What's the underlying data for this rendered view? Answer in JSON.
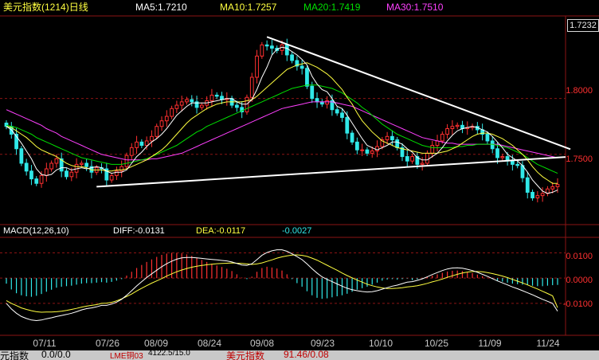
{
  "header": {
    "title": "美元指数(1214)日线",
    "ma5": "MA5:1.7210",
    "ma10": "MA10:1.7257",
    "ma20": "MA20:1.7419",
    "ma30": "MA30:1.7510"
  },
  "macd_header": {
    "label": "MACD(12,26,10)",
    "diff": "DIFF:-0.0131",
    "dea": "DEA:-0.0117",
    "macd": "-0.0027"
  },
  "price_axis": {
    "current": "1.7232",
    "ticks": [
      "1.8000",
      "1.7500"
    ]
  },
  "macd_axis": {
    "ticks": [
      "0.0100",
      "0.0000",
      "-0.0100"
    ]
  },
  "x_axis": {
    "ticks": [
      "07/11",
      "07/26",
      "08/09",
      "08/24",
      "09/08",
      "09/23",
      "10/10",
      "10/25",
      "11/09",
      "11/24"
    ]
  },
  "status_bar": {
    "left": "元指数",
    "left_value": "0.0/0.0",
    "mid": "LME铜03",
    "mid_value": "4122.5/15.0",
    "right": "美元指数",
    "right_value": "91.46/0.08"
  },
  "colors": {
    "up": "#ff3030",
    "down": "#30e8e8",
    "ma5": "#ffffff",
    "ma10": "#ffff40",
    "ma20": "#00e000",
    "ma30": "#ff40ff",
    "grid": "#8c1414",
    "trendline": "#ffffff"
  },
  "chart_data": [
    {
      "type": "candlestick",
      "title": "美元指数(1214)日线",
      "ylim": [
        1.6885,
        1.8725
      ],
      "x": [
        "07/11",
        "07/26",
        "08/09",
        "08/24",
        "09/08",
        "09/23",
        "10/10",
        "10/25",
        "11/09",
        "11/24"
      ],
      "close": [
        1.775,
        1.768,
        1.755,
        1.742,
        1.735,
        1.728,
        1.724,
        1.731,
        1.737,
        1.742,
        1.746,
        1.735,
        1.73,
        1.734,
        1.741,
        1.742,
        1.739,
        1.734,
        1.738,
        1.737,
        1.727,
        1.731,
        1.735,
        1.739,
        1.749,
        1.756,
        1.761,
        1.758,
        1.762,
        1.766,
        1.775,
        1.78,
        1.784,
        1.791,
        1.794,
        1.797,
        1.799,
        1.797,
        1.792,
        1.794,
        1.798,
        1.803,
        1.802,
        1.799,
        1.8,
        1.794,
        1.792,
        1.788,
        1.801,
        1.819,
        1.838,
        1.848,
        1.847,
        1.845,
        1.843,
        1.848,
        1.839,
        1.834,
        1.829,
        1.827,
        1.811,
        1.8,
        1.797,
        1.795,
        1.798,
        1.79,
        1.787,
        1.783,
        1.769,
        1.761,
        1.754,
        1.754,
        1.751,
        1.753,
        1.757,
        1.763,
        1.766,
        1.763,
        1.756,
        1.748,
        1.744,
        1.748,
        1.741,
        1.742,
        1.751,
        1.758,
        1.762,
        1.768,
        1.773,
        1.775,
        1.776,
        1.773,
        1.774,
        1.775,
        1.772,
        1.768,
        1.762,
        1.755,
        1.747,
        1.748,
        1.744,
        1.741,
        1.74,
        1.729,
        1.716,
        1.711,
        1.713,
        1.715,
        1.719,
        1.721,
        1.723
      ],
      "ma5": [
        1.775,
        1.772,
        1.766,
        1.76,
        1.753,
        1.746,
        1.737,
        1.732,
        1.731,
        1.732,
        1.736,
        1.738,
        1.738,
        1.736,
        1.737,
        1.738,
        1.737,
        1.738,
        1.739,
        1.738,
        1.735,
        1.733,
        1.734,
        1.734,
        1.736,
        1.742,
        1.748,
        1.752,
        1.757,
        1.761,
        1.764,
        1.768,
        1.773,
        1.779,
        1.785,
        1.789,
        1.793,
        1.796,
        1.796,
        1.796,
        1.796,
        1.797,
        1.798,
        1.799,
        1.8,
        1.8,
        1.797,
        1.795,
        1.795,
        1.799,
        1.808,
        1.819,
        1.828,
        1.839,
        1.844,
        1.846,
        1.845,
        1.842,
        1.839,
        1.835,
        1.83,
        1.82,
        1.813,
        1.808,
        1.806,
        1.8,
        1.793,
        1.791,
        1.785,
        1.778,
        1.771,
        1.764,
        1.758,
        1.756,
        1.754,
        1.756,
        1.758,
        1.761,
        1.761,
        1.759,
        1.755,
        1.752,
        1.747,
        1.745,
        1.745,
        1.748,
        1.751,
        1.756,
        1.762,
        1.767,
        1.771,
        1.773,
        1.774,
        1.775,
        1.774,
        1.772,
        1.77,
        1.766,
        1.761,
        1.756,
        1.75,
        1.747,
        1.744,
        1.74,
        1.734,
        1.727,
        1.722,
        1.717,
        1.715,
        1.716,
        1.718
      ],
      "ma10": [
        1.775,
        1.774,
        1.771,
        1.768,
        1.765,
        1.761,
        1.757,
        1.754,
        1.752,
        1.75,
        1.748,
        1.745,
        1.742,
        1.74,
        1.739,
        1.739,
        1.738,
        1.736,
        1.736,
        1.736,
        1.735,
        1.735,
        1.736,
        1.736,
        1.737,
        1.739,
        1.741,
        1.743,
        1.745,
        1.748,
        1.751,
        1.754,
        1.758,
        1.763,
        1.768,
        1.773,
        1.778,
        1.782,
        1.785,
        1.788,
        1.791,
        1.793,
        1.795,
        1.796,
        1.797,
        1.797,
        1.797,
        1.797,
        1.798,
        1.799,
        1.802,
        1.806,
        1.81,
        1.814,
        1.818,
        1.822,
        1.826,
        1.828,
        1.83,
        1.831,
        1.832,
        1.83,
        1.828,
        1.825,
        1.822,
        1.818,
        1.813,
        1.808,
        1.801,
        1.795,
        1.787,
        1.78,
        1.775,
        1.77,
        1.766,
        1.762,
        1.76,
        1.758,
        1.756,
        1.755,
        1.754,
        1.753,
        1.752,
        1.751,
        1.751,
        1.751,
        1.751,
        1.752,
        1.753,
        1.755,
        1.757,
        1.76,
        1.763,
        1.766,
        1.768,
        1.769,
        1.769,
        1.768,
        1.766,
        1.764,
        1.761,
        1.758,
        1.754,
        1.75,
        1.745,
        1.739,
        1.734,
        1.73,
        1.727,
        1.724,
        1.724
      ],
      "ma20": [
        1.776,
        1.775,
        1.774,
        1.772,
        1.77,
        1.768,
        1.765,
        1.763,
        1.761,
        1.759,
        1.757,
        1.755,
        1.753,
        1.751,
        1.749,
        1.747,
        1.746,
        1.745,
        1.744,
        1.743,
        1.742,
        1.741,
        1.741,
        1.741,
        1.742,
        1.743,
        1.744,
        1.745,
        1.746,
        1.748,
        1.75,
        1.752,
        1.754,
        1.756,
        1.758,
        1.761,
        1.764,
        1.767,
        1.77,
        1.772,
        1.775,
        1.777,
        1.779,
        1.781,
        1.783,
        1.785,
        1.787,
        1.789,
        1.791,
        1.793,
        1.795,
        1.797,
        1.799,
        1.801,
        1.803,
        1.805,
        1.807,
        1.809,
        1.81,
        1.811,
        1.812,
        1.812,
        1.812,
        1.811,
        1.81,
        1.809,
        1.807,
        1.805,
        1.802,
        1.799,
        1.796,
        1.792,
        1.789,
        1.785,
        1.781,
        1.777,
        1.774,
        1.771,
        1.768,
        1.766,
        1.764,
        1.762,
        1.76,
        1.758,
        1.757,
        1.756,
        1.756,
        1.756,
        1.756,
        1.756,
        1.757,
        1.757,
        1.758,
        1.758,
        1.759,
        1.759,
        1.759,
        1.759,
        1.758,
        1.757,
        1.756,
        1.754,
        1.752,
        1.75,
        1.747,
        1.744,
        1.741,
        1.739,
        1.737,
        1.735,
        1.733
      ],
      "ma30": [
        1.79,
        1.788,
        1.786,
        1.784,
        1.782,
        1.78,
        1.778,
        1.776,
        1.773,
        1.771,
        1.769,
        1.766,
        1.764,
        1.762,
        1.76,
        1.758,
        1.756,
        1.754,
        1.752,
        1.75,
        1.749,
        1.748,
        1.747,
        1.746,
        1.745,
        1.745,
        1.745,
        1.745,
        1.745,
        1.746,
        1.746,
        1.747,
        1.748,
        1.749,
        1.75,
        1.751,
        1.753,
        1.755,
        1.757,
        1.759,
        1.761,
        1.763,
        1.765,
        1.767,
        1.769,
        1.771,
        1.773,
        1.775,
        1.777,
        1.779,
        1.781,
        1.783,
        1.785,
        1.787,
        1.789,
        1.791,
        1.792,
        1.793,
        1.794,
        1.795,
        1.796,
        1.797,
        1.797,
        1.797,
        1.797,
        1.797,
        1.796,
        1.795,
        1.794,
        1.793,
        1.791,
        1.789,
        1.787,
        1.785,
        1.783,
        1.781,
        1.779,
        1.777,
        1.775,
        1.773,
        1.771,
        1.769,
        1.767,
        1.765,
        1.764,
        1.763,
        1.762,
        1.761,
        1.76,
        1.76,
        1.759,
        1.759,
        1.759,
        1.759,
        1.759,
        1.759,
        1.759,
        1.759,
        1.759,
        1.758,
        1.757,
        1.756,
        1.755,
        1.754,
        1.753,
        1.752,
        1.751,
        1.75,
        1.749,
        1.748,
        1.747
      ]
    },
    {
      "type": "bar",
      "title": "MACD(12,26,10)",
      "ylim": [
        -0.0217,
        0.0155
      ],
      "values": [
        -0.0022,
        -0.0045,
        -0.006,
        -0.0068,
        -0.0072,
        -0.0074,
        -0.007,
        -0.0063,
        -0.0054,
        -0.0046,
        -0.0038,
        -0.0034,
        -0.0032,
        -0.003,
        -0.0026,
        -0.0022,
        -0.002,
        -0.002,
        -0.0018,
        -0.0016,
        -0.0018,
        -0.0015,
        -0.001,
        -0.0004,
        0.001,
        0.0025,
        0.004,
        0.0052,
        0.0064,
        0.0074,
        0.0084,
        0.0092,
        0.0097,
        0.01,
        0.01,
        0.0098,
        0.0094,
        0.0088,
        0.008,
        0.0072,
        0.0064,
        0.0057,
        0.005,
        0.0044,
        0.0037,
        0.0028,
        0.0015,
        0.0002,
        -0.0004,
        0.0006,
        0.0025,
        0.004,
        0.0045,
        0.0042,
        0.0038,
        0.003,
        0.0015,
        -0.0004,
        -0.002,
        -0.0034,
        -0.0052,
        -0.0068,
        -0.0078,
        -0.0082,
        -0.008,
        -0.0076,
        -0.0072,
        -0.0068,
        -0.0062,
        -0.0054,
        -0.0046,
        -0.004,
        -0.0034,
        -0.0026,
        -0.0018,
        -0.001,
        -0.0006,
        -0.0004,
        -0.0006,
        -0.0004,
        -0.0002,
        -0.0008,
        -0.0005,
        -0.0002,
        0.0004,
        0.001,
        0.0015,
        0.0021,
        0.0026,
        0.0029,
        0.003,
        0.0028,
        0.0024,
        0.002,
        0.0014,
        0.0008,
        0.0002,
        -0.0004,
        -0.001,
        -0.0014,
        -0.0018,
        -0.0022,
        -0.0024,
        -0.0026,
        -0.0028,
        -0.003,
        -0.0032,
        -0.0032,
        -0.003,
        -0.0028,
        -0.0027
      ],
      "diff": [
        -0.01,
        -0.0122,
        -0.0139,
        -0.0152,
        -0.016,
        -0.0166,
        -0.0168,
        -0.0166,
        -0.0161,
        -0.0157,
        -0.0152,
        -0.0148,
        -0.0144,
        -0.0139,
        -0.0133,
        -0.0126,
        -0.0121,
        -0.0118,
        -0.0114,
        -0.0108,
        -0.0108,
        -0.0103,
        -0.0095,
        -0.0084,
        -0.0068,
        -0.005,
        -0.0031,
        -0.0014,
        0.0002,
        0.0017,
        0.0031,
        0.0045,
        0.0057,
        0.0067,
        0.0075,
        0.008,
        0.0082,
        0.0082,
        0.008,
        0.0078,
        0.0076,
        0.0074,
        0.0072,
        0.007,
        0.0068,
        0.0064,
        0.0058,
        0.0052,
        0.005,
        0.0057,
        0.0073,
        0.009,
        0.0101,
        0.0108,
        0.0112,
        0.0112,
        0.0106,
        0.0096,
        0.0085,
        0.0073,
        0.0056,
        0.0037,
        0.002,
        0.0005,
        -0.0005,
        -0.0014,
        -0.0023,
        -0.0032,
        -0.004,
        -0.0046,
        -0.005,
        -0.0053,
        -0.0055,
        -0.0054,
        -0.005,
        -0.0044,
        -0.0038,
        -0.0032,
        -0.0028,
        -0.0022,
        -0.0016,
        -0.0014,
        -0.0009,
        -0.0003,
        0.0005,
        0.0014,
        0.0022,
        0.003,
        0.0036,
        0.004,
        0.0041,
        0.0039,
        0.0035,
        0.003,
        0.0023,
        0.0015,
        0.0007,
        -0.0002,
        -0.0011,
        -0.0019,
        -0.0027,
        -0.0035,
        -0.0042,
        -0.005,
        -0.0058,
        -0.0066,
        -0.0075,
        -0.0084,
        -0.0092,
        -0.01,
        -0.0131
      ],
      "dea": [
        -0.0089,
        -0.01,
        -0.0109,
        -0.0118,
        -0.0124,
        -0.0129,
        -0.0133,
        -0.0135,
        -0.0134,
        -0.0134,
        -0.0133,
        -0.0131,
        -0.0128,
        -0.0124,
        -0.012,
        -0.0115,
        -0.0111,
        -0.0108,
        -0.0105,
        -0.01,
        -0.0099,
        -0.0096,
        -0.009,
        -0.0082,
        -0.0073,
        -0.0063,
        -0.0051,
        -0.004,
        -0.003,
        -0.002,
        -0.0011,
        -0.0002,
        0.0008,
        0.0017,
        0.0025,
        0.0032,
        0.0038,
        0.0043,
        0.0047,
        0.005,
        0.0053,
        0.0055,
        0.0057,
        0.0058,
        0.0059,
        0.006,
        0.0059,
        0.0058,
        0.0056,
        0.0054,
        0.0056,
        0.006,
        0.0066,
        0.0072,
        0.0079,
        0.0084,
        0.0088,
        0.0091,
        0.0092,
        0.009,
        0.0086,
        0.0079,
        0.0071,
        0.0061,
        0.0051,
        0.0041,
        0.0031,
        0.002,
        0.001,
        0.0001,
        -0.0008,
        -0.0016,
        -0.0024,
        -0.003,
        -0.0035,
        -0.0039,
        -0.0041,
        -0.0041,
        -0.004,
        -0.0038,
        -0.0035,
        -0.0033,
        -0.003,
        -0.0026,
        -0.0021,
        -0.0015,
        -0.001,
        -0.0004,
        0.0003,
        0.0009,
        0.0015,
        0.002,
        0.0024,
        0.0026,
        0.0026,
        0.0025,
        0.0022,
        0.0018,
        0.0013,
        0.0008,
        0.0002,
        -0.0005,
        -0.0012,
        -0.0019,
        -0.0027,
        -0.0035,
        -0.0043,
        -0.0052,
        -0.0061,
        -0.007,
        -0.0117
      ]
    }
  ]
}
